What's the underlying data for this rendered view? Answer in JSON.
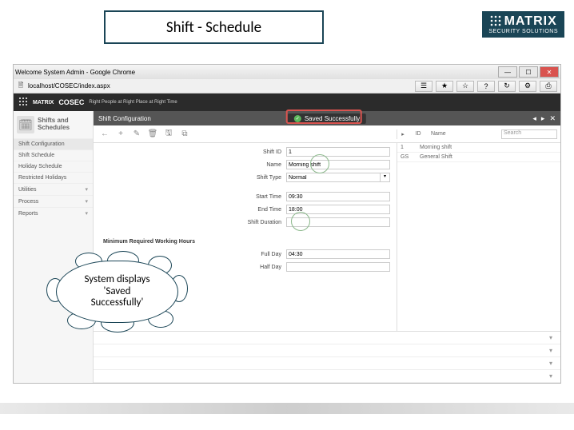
{
  "branding": {
    "brand_name": "MATRIX",
    "brand_tagline": "SECURITY SOLUTIONS"
  },
  "title_box": "Shift - Schedule",
  "browser": {
    "window_title": "Welcome System Admin - Google Chrome",
    "url": "localhost/COSEC/index.aspx",
    "toolbar_icons": [
      "☰",
      "★",
      "☆",
      "?",
      "↻",
      "⚙",
      "⎙"
    ]
  },
  "app": {
    "product": "COSEC",
    "tagline": "Right People at Right Place at Right Time"
  },
  "sidebar": {
    "header_line1": "Shifts and",
    "header_line2": "Schedules",
    "items": [
      {
        "label": "Shift Configuration"
      },
      {
        "label": "Shift Schedule"
      },
      {
        "label": "Holiday Schedule"
      },
      {
        "label": "Restricted Holidays"
      },
      {
        "label": "Utilities"
      },
      {
        "label": "Process"
      },
      {
        "label": "Reports"
      }
    ]
  },
  "main_header": {
    "title": "Shift Configuration",
    "success_text": "Saved Successfully"
  },
  "list_header": {
    "id_col": "ID",
    "name_col": "Name",
    "search_placeholder": "Search"
  },
  "form": {
    "shift_id_label": "Shift ID",
    "shift_id_value": "1",
    "name_label": "Name",
    "name_value": "Morning shift",
    "shift_type_label": "Shift Type",
    "shift_type_value": "Normal",
    "start_time_label": "Start Time",
    "start_time_value": "09:30",
    "end_time_label": "End Time",
    "end_time_value": "18:00",
    "shift_duration_label": "Shift Duration",
    "section_label": "Minimum Required Working Hours",
    "full_day_label": "Full Day",
    "full_day_value": "04:30",
    "half_day_label": "Half Day"
  },
  "shift_list": [
    {
      "id": "1",
      "name": "Morning shift"
    },
    {
      "id": "GS",
      "name": "General Shift"
    }
  ],
  "callout": {
    "line1": "System displays",
    "line2": "'Saved",
    "line3": "Successfully'"
  }
}
